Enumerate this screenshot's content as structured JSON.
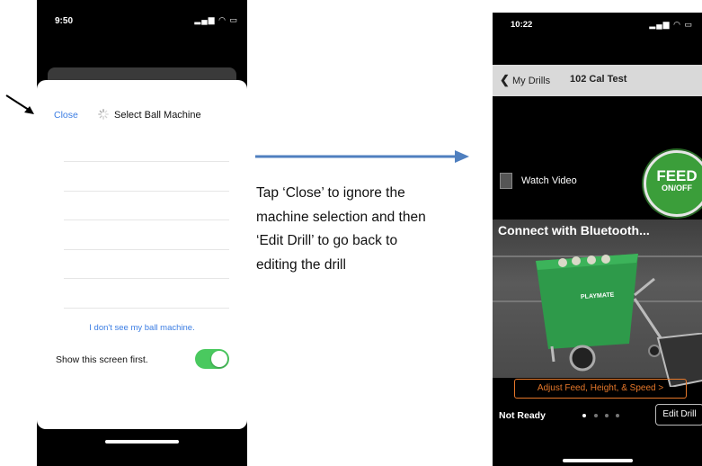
{
  "left_phone": {
    "time": "9:50",
    "close_label": "Close",
    "title": "Select Ball Machine",
    "not_see_label": "I don't see my ball machine.",
    "show_first_label": "Show this screen first.",
    "toggle_on": true
  },
  "instruction": {
    "line1": "Tap ‘Close’ to ignore the",
    "line2": "machine selection and then",
    "line3": "‘Edit Drill’ to go back to",
    "line4": "editing the drill"
  },
  "right_phone": {
    "time": "10:22",
    "back_label": "My Drills",
    "drill_title": "102 Cal Test",
    "watch_video_label": "Watch Video",
    "feed_label": "FEED",
    "feed_sub_label": "ON/OFF",
    "connect_label": "Connect with Bluetooth...",
    "brand_label": "PLAYMATE",
    "adjust_label": "Adjust Feed, Height, & Speed >",
    "status_label": "Not Ready",
    "edit_label": "Edit Drill"
  },
  "colors": {
    "link_blue": "#3b7de3",
    "toggle_green": "#4ac95f",
    "arrow_blue": "#4f7fbf",
    "accent_orange": "#e5772a",
    "feed_green": "#3b9e3a",
    "machine_green": "#2e9a4a"
  }
}
